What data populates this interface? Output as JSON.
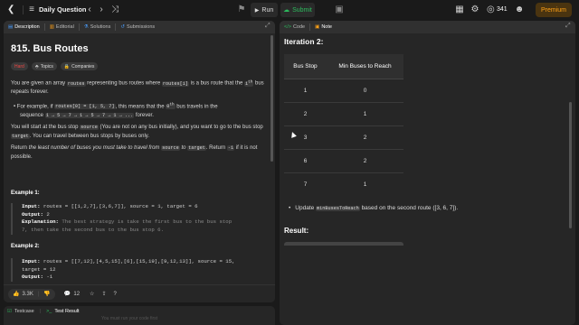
{
  "topbar": {
    "title": "Daily Question",
    "run": "Run",
    "submit": "Submit",
    "coins": "341",
    "premium": "Premium"
  },
  "left": {
    "tabs": [
      "Description",
      "Editorial",
      "Solutions",
      "Submissions"
    ],
    "title": "815. Bus Routes",
    "badges": [
      "Hard",
      "Topics",
      "Companies"
    ],
    "p1a": "You are given an array ",
    "p1code": "routes",
    "p1b": " representing bus routes where ",
    "p1code2": "routes[i]",
    "p1c": " is a bus route that the ",
    "p1sup": "i",
    "p1supth": "th",
    "p1d": " bus repeats forever.",
    "bullet_a": "For example, if ",
    "bullet_code": "routes[0] = [1, 5, 7]",
    "bullet_b": ", this means that the ",
    "bullet_sup": "0",
    "bullet_supth": "th",
    "bullet_c": " bus travels in the",
    "bullet_d": "sequence ",
    "bullet_seq": "1 → 5 → 7 → 1 → 5 → 7 → 1 → ...",
    "bullet_e": " forever.",
    "p2a": "You will start at the bus stop ",
    "p2code": "source",
    "p2b": " (You are not on any bus initially), and you want to go to the bus stop ",
    "p2code2": "target",
    "p2c": ". You can travel between bus stops by buses only.",
    "p3a": "Return ",
    "p3i": "the least number of buses you must take to travel from ",
    "p3code": "source",
    "p3i2": " to ",
    "p3code2": "target",
    "p3b": ". Return ",
    "p3code3": "-1",
    "p3c": " if it is not possible.",
    "ex1": "Example 1:",
    "ex1_input_label": "Input:",
    "ex1_input": "routes = [[1,2,7],[3,6,7]], source = 1, target = 6",
    "ex1_output_label": "Output:",
    "ex1_output": "2",
    "ex1_expl_label": "Explanation:",
    "ex1_expl1": "The best strategy is take the first bus to the bus stop",
    "ex1_expl2": "7, then take the second bus to the bus stop 6.",
    "ex2": "Example 2:",
    "ex2_input_label": "Input:",
    "ex2_input1": "routes = [[7,12],[4,5,15],[6],[15,19],[9,12,13]], source = 15,",
    "ex2_input2": "target = 12",
    "ex2_output_label": "Output:",
    "ex2_output": "-1",
    "likes": "3.3K",
    "comments": "12",
    "testcase": "Testcase",
    "testresult": "Test Result",
    "faint": "You must run your code first"
  },
  "right": {
    "tabs": [
      "Code",
      "Note"
    ],
    "heading": "Iteration 2:",
    "table": {
      "headers": [
        "Bus Stop",
        "Min Buses to Reach"
      ],
      "rows": [
        [
          "1",
          "0"
        ],
        [
          "2",
          "1"
        ],
        [
          "3",
          "2"
        ],
        [
          "6",
          "2"
        ],
        [
          "7",
          "1"
        ]
      ]
    },
    "update_a": "Update ",
    "update_code": "minBusesToReach",
    "update_b": " based on the second route ([3, 6, 7]).",
    "result": "Result:"
  },
  "colors": {
    "hard": "#ef4743",
    "submit": "#2cbb5d",
    "premium": "#ffa116"
  }
}
